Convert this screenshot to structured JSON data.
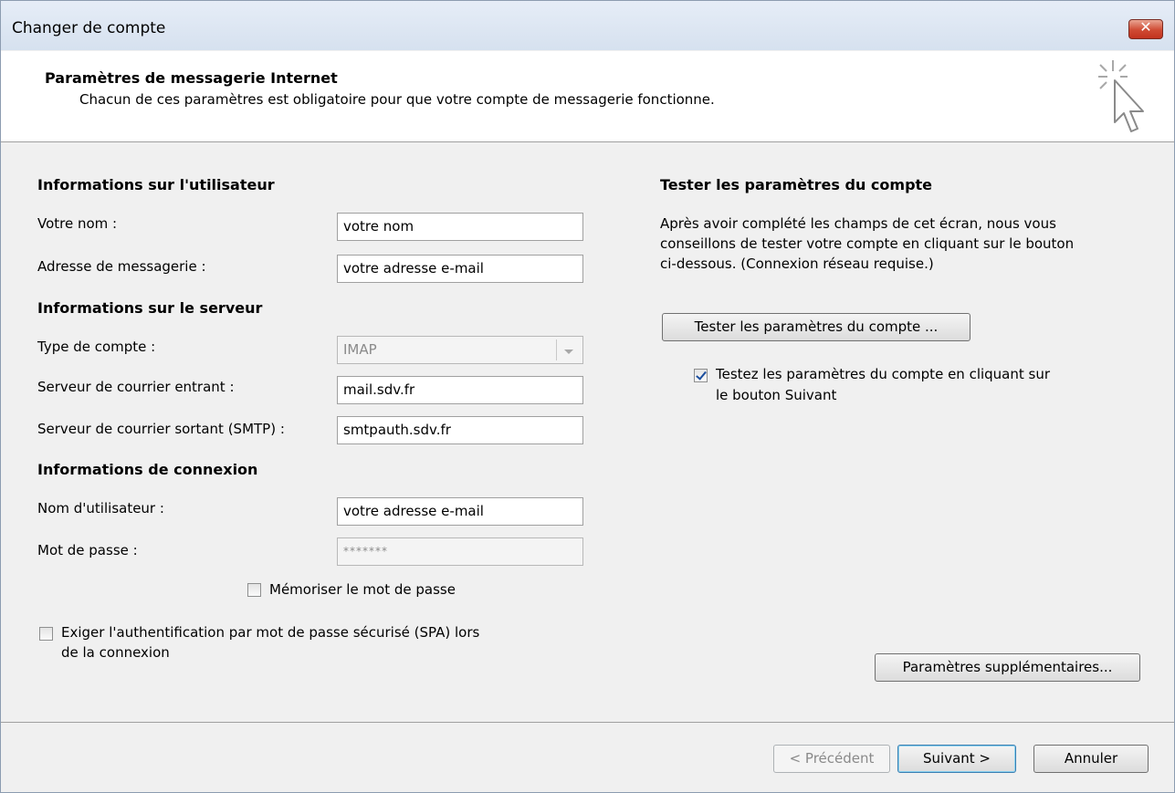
{
  "window": {
    "title": "Changer de compte",
    "close_glyph": "✕"
  },
  "header": {
    "title": "Paramètres de messagerie Internet",
    "subtitle": "Chacun de ces paramètres est obligatoire pour que votre compte de messagerie fonctionne."
  },
  "user_info": {
    "heading": "Informations sur l'utilisateur",
    "name_label": "Votre nom :",
    "name_value": "votre nom",
    "email_label": "Adresse de messagerie :",
    "email_value": "votre adresse e-mail"
  },
  "server_info": {
    "heading": "Informations sur le serveur",
    "type_label": "Type de compte :",
    "type_value": "IMAP",
    "incoming_label": "Serveur de courrier entrant :",
    "incoming_value": "mail.sdv.fr",
    "outgoing_label": "Serveur de courrier sortant (SMTP) :",
    "outgoing_value": "smtpauth.sdv.fr"
  },
  "login_info": {
    "heading": "Informations de connexion",
    "username_label": "Nom d'utilisateur :",
    "username_value": "votre adresse e-mail",
    "password_label": "Mot de passe :",
    "password_value": "*******",
    "remember_label": "Mémoriser le mot de passe",
    "remember_checked": false,
    "spa_label_line1": "Exiger l'authentification par mot de passe sécurisé (SPA) lors",
    "spa_label_line2": "de la connexion",
    "spa_checked": false
  },
  "test": {
    "heading": "Tester les paramètres du compte",
    "desc_line1": "Après avoir complété les champs de cet écran, nous vous",
    "desc_line2": "conseillons de tester votre compte en cliquant sur le bouton",
    "desc_line3": "ci-dessous. (Connexion réseau requise.)",
    "button": "Tester les paramètres du compte ...",
    "auto_label_line1": "Testez les paramètres du compte en cliquant sur",
    "auto_label_line2": "le bouton Suivant",
    "auto_checked": true
  },
  "more_settings_button": "Paramètres supplémentaires...",
  "footer": {
    "prev": "< Précédent",
    "next": "Suivant >",
    "cancel": "Annuler"
  },
  "icons": {
    "close": "close-icon",
    "header": "cursor-sparkle-icon",
    "combo": "chevron-down-icon"
  }
}
